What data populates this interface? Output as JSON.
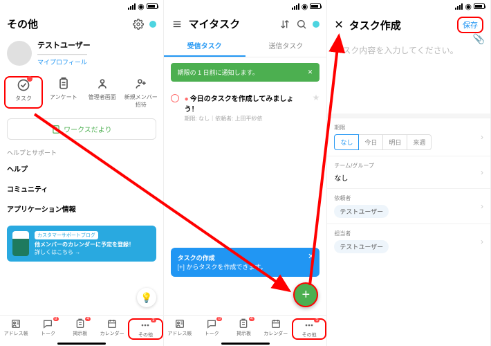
{
  "s1": {
    "title": "その他",
    "profile": {
      "name": "テストユーザー",
      "sub": "————————",
      "link": "マイプロフィール"
    },
    "iconrow": [
      {
        "label": "タスク"
      },
      {
        "label": "アンケート"
      },
      {
        "label": "管理者画面"
      },
      {
        "label": "新規メンバー\n招待"
      }
    ],
    "widebtn": "ワークスだより",
    "help_section": "ヘルプとサポート",
    "items": [
      "ヘルプ",
      "コミュニティ",
      "アプリケーション情報"
    ],
    "banner": {
      "tag": "カスタマーサポートブログ",
      "line1": "他メンバーのカレンダーに予定を登録！",
      "line2": "詳しくはこちら →"
    }
  },
  "s2": {
    "title": "マイタスク",
    "tabs": [
      "受信タスク",
      "送信タスク"
    ],
    "toast": "期限の 1 日前に通知します。",
    "task": {
      "title": "今日のタスクを作成してみましょう！",
      "sub": "期限: なし｜依頼者: 上田平紗依"
    },
    "bluetoast": {
      "t1": "タスクの作成",
      "t2": "[+] からタスクを作成できます。"
    }
  },
  "s3": {
    "title": "タスク作成",
    "save": "保存",
    "placeholder": "タスク内容を入力してください。",
    "rows": {
      "deadline_label": "期限",
      "deadline_chips": [
        "なし",
        "今日",
        "明日",
        "来週"
      ],
      "team_label": "チーム/グループ",
      "team_val": "なし",
      "requester_label": "依頼者",
      "requester_val": "テストユーザー",
      "assignee_label": "担当者",
      "assignee_val": "テストユーザー"
    }
  },
  "tabbar": [
    {
      "label": "アドレス帳"
    },
    {
      "label": "トーク",
      "badge": "8"
    },
    {
      "label": "掲示板",
      "badge": "4"
    },
    {
      "label": "カレンダー"
    },
    {
      "label": "その他",
      "badge": "1"
    }
  ]
}
